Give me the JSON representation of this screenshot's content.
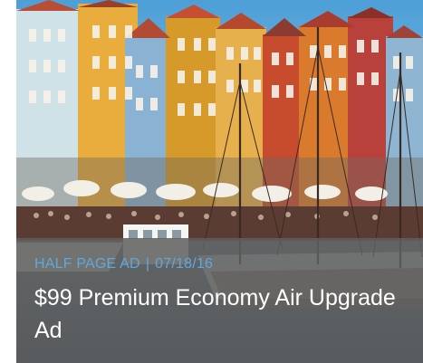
{
  "card": {
    "image_icon": "harbor-photo",
    "category": "HALF PAGE AD",
    "separator": "|",
    "date": "07/18/16",
    "title": "$99 Premium Economy Air Upgrade Ad"
  },
  "colors": {
    "meta_text": "#5fa9df",
    "title_text": "#ffffff",
    "caption_bg": "#5f5f5f"
  }
}
